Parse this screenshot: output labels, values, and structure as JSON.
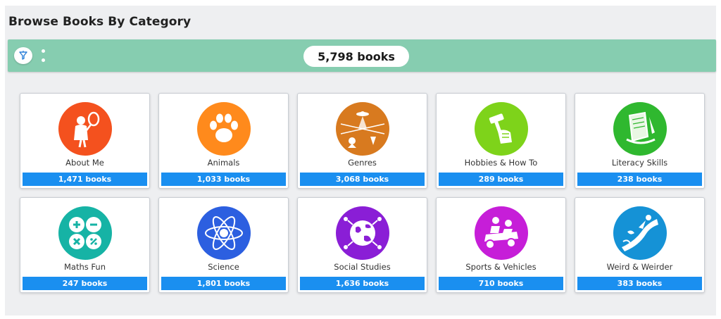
{
  "page": {
    "title": "Browse Books By Category"
  },
  "toolbar": {
    "total_count": "5,798 books"
  },
  "categories": [
    {
      "name": "About Me",
      "count": "1,471 books",
      "color": "#f4511e",
      "icon": "person-mirror-icon"
    },
    {
      "name": "Animals",
      "count": "1,033 books",
      "color": "#ff8a1c",
      "icon": "paw-print-icon"
    },
    {
      "name": "Genres",
      "count": "3,068 books",
      "color": "#d87a1f",
      "icon": "genres-collage-icon"
    },
    {
      "name": "Hobbies & How To",
      "count": "289 books",
      "color": "#7ed31a",
      "icon": "hammer-hand-icon"
    },
    {
      "name": "Literacy Skills",
      "count": "238 books",
      "color": "#2fb82f",
      "icon": "scroll-quill-icon"
    },
    {
      "name": "Maths Fun",
      "count": "247 books",
      "color": "#16b3a5",
      "icon": "math-operators-icon"
    },
    {
      "name": "Science",
      "count": "1,801 books",
      "color": "#2c5fe0",
      "icon": "atom-icon"
    },
    {
      "name": "Social Studies",
      "count": "1,636 books",
      "color": "#8a1ed6",
      "icon": "globe-people-icon"
    },
    {
      "name": "Sports & Vehicles",
      "count": "710 books",
      "color": "#c61ed8",
      "icon": "go-kart-icon"
    },
    {
      "name": "Weird & Weirder",
      "count": "383 books",
      "color": "#1592d6",
      "icon": "water-slide-icon"
    }
  ]
}
